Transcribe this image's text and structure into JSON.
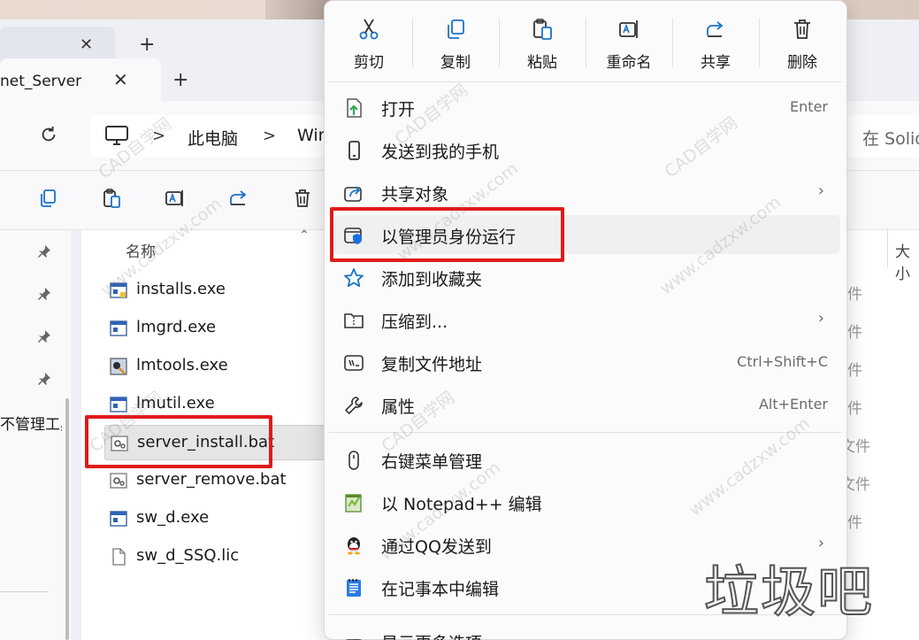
{
  "explorer": {
    "tabs": [
      {
        "label": ""
      },
      {
        "label": "net_Server"
      }
    ],
    "breadcrumb": [
      "此电脑",
      "Win"
    ],
    "search_placeholder": "在 Solid",
    "nav_text": "不管理工具",
    "columns": {
      "name": "名称",
      "size": "大小"
    },
    "files": [
      {
        "name": "installs.exe",
        "icon": "exe-window-icon"
      },
      {
        "name": "lmgrd.exe",
        "icon": "exe-window-icon"
      },
      {
        "name": "lmtools.exe",
        "icon": "tool-app-icon"
      },
      {
        "name": "lmutil.exe",
        "icon": "exe-window-icon"
      },
      {
        "name": "server_install.bat",
        "icon": "batch-gear-icon",
        "selected": true
      },
      {
        "name": "server_remove.bat",
        "icon": "batch-gear-icon"
      },
      {
        "name": "sw_d.exe",
        "icon": "exe-window-icon"
      },
      {
        "name": "sw_d_SSQ.lic",
        "icon": "blank-file-icon"
      }
    ],
    "type_fragments": [
      "件",
      "件",
      "件",
      "件",
      "文件",
      "文件",
      "件"
    ]
  },
  "context_menu": {
    "quick_actions": [
      {
        "label": "剪切",
        "icon": "scissors-icon"
      },
      {
        "label": "复制",
        "icon": "copy-icon"
      },
      {
        "label": "粘贴",
        "icon": "paste-icon"
      },
      {
        "label": "重命名",
        "icon": "rename-icon"
      },
      {
        "label": "共享",
        "icon": "share-icon"
      },
      {
        "label": "删除",
        "icon": "trash-icon"
      }
    ],
    "items": [
      {
        "label": "打开",
        "shortcut": "Enter",
        "icon": "open-file-icon"
      },
      {
        "label": "发送到我的手机",
        "icon": "phone-icon"
      },
      {
        "label": "共享对象",
        "icon": "share-icon",
        "submenu": true
      },
      {
        "label": "以管理员身份运行",
        "icon": "admin-shield-icon",
        "hovered": true
      },
      {
        "label": "添加到收藏夹",
        "icon": "star-icon"
      },
      {
        "label": "压缩到...",
        "icon": "zip-folder-icon",
        "submenu": true
      },
      {
        "label": "复制文件地址",
        "shortcut": "Ctrl+Shift+C",
        "icon": "copy-path-icon"
      },
      {
        "label": "属性",
        "shortcut": "Alt+Enter",
        "icon": "wrench-icon"
      },
      {
        "label": "右键菜单管理",
        "icon": "mouse-icon"
      },
      {
        "label": "以 Notepad++ 编辑",
        "icon": "notepadpp-icon"
      },
      {
        "label": "通过QQ发送到",
        "icon": "qq-penguin-icon",
        "submenu": true
      },
      {
        "label": "在记事本中编辑",
        "icon": "notepad-icon"
      },
      {
        "label": "显示更多选项",
        "icon": "more-options-icon"
      }
    ]
  },
  "watermarks": [
    "CAD自学网",
    "CAD自学网",
    "www.cadzxw.com",
    "CAD自学网",
    "www.cadzxw.com",
    "www.cadzxw.com",
    "CAD自学网",
    "www.cadzxw.com",
    "CAD自学网",
    "www.cadzxw.com"
  ],
  "logo_text": "垃圾吧",
  "colors": {
    "highlight_red": "#e01a1a",
    "selected_row": "#e5e5e5",
    "admin_shield": "#1a6fe0",
    "open_arrow": "#2fa84f",
    "notepadpp_green": "#7dbb3c",
    "qq_penguin": "#222222",
    "notepad_blue": "#2a7be4"
  }
}
